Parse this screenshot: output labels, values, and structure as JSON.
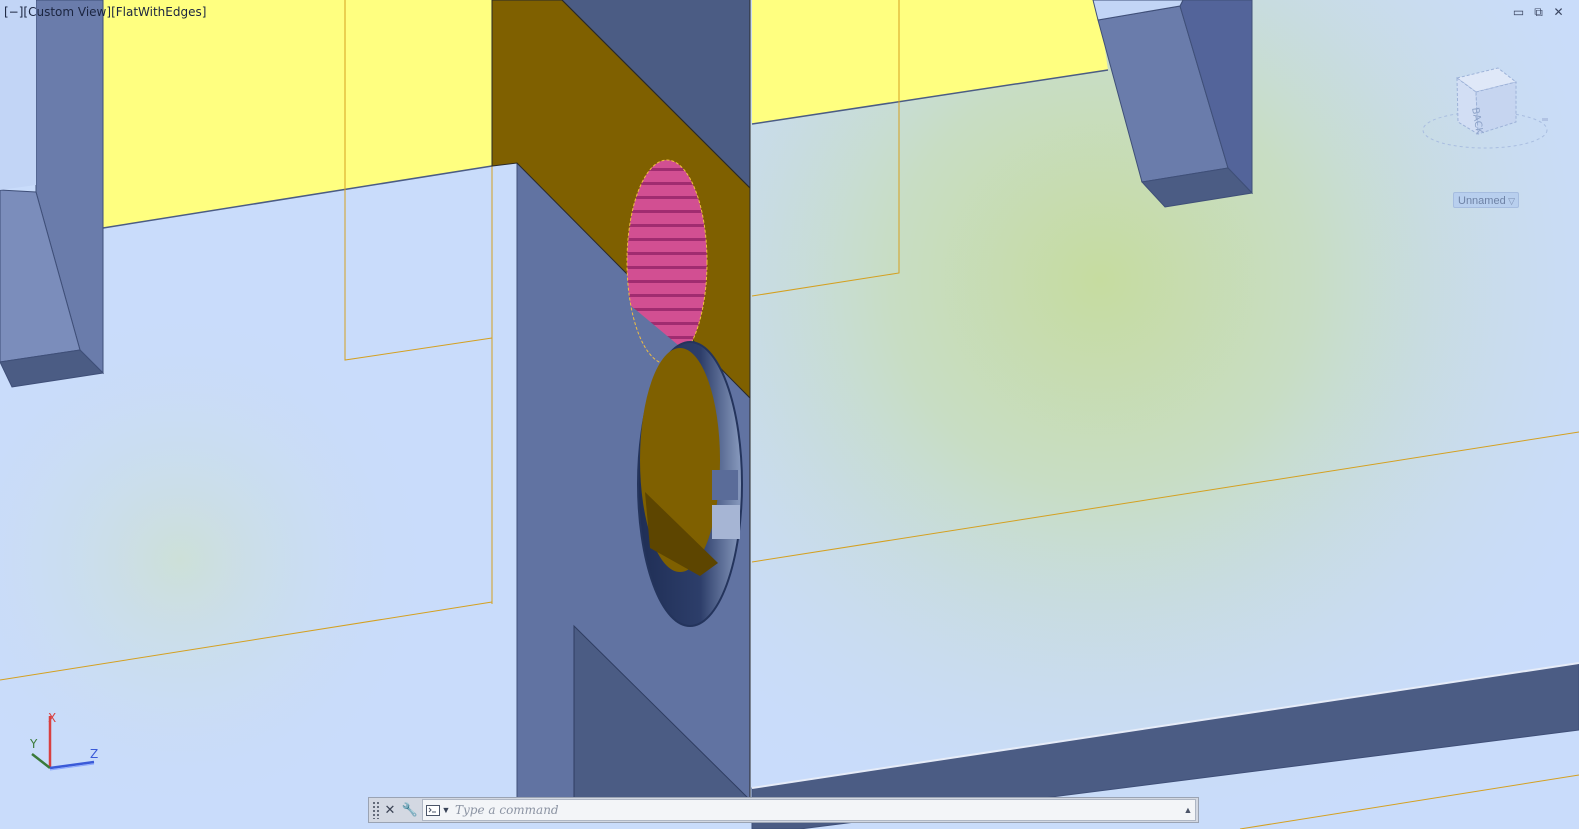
{
  "viewport": {
    "view_control": "[−]",
    "view_name": "[Custom View]",
    "visual_style": "[FlatWithEdges]"
  },
  "window_controls": {
    "minimize": "▭",
    "restore": "⧉",
    "close": "✕"
  },
  "viewcube": {
    "face_label": "BACK"
  },
  "named_view": {
    "label": "Unnamed"
  },
  "ucs": {
    "x_label": "X",
    "y_label": "Y",
    "z_label": "Z"
  },
  "command_line": {
    "placeholder": "Type a command",
    "value": ""
  },
  "colors": {
    "background": "#c9dcfb",
    "face_yellow": "#ffff80",
    "face_dark_yellow": "#7f6000",
    "face_steel": "#6173a2",
    "face_steel_dark": "#4b5c84",
    "section_magenta": "#c04080"
  }
}
